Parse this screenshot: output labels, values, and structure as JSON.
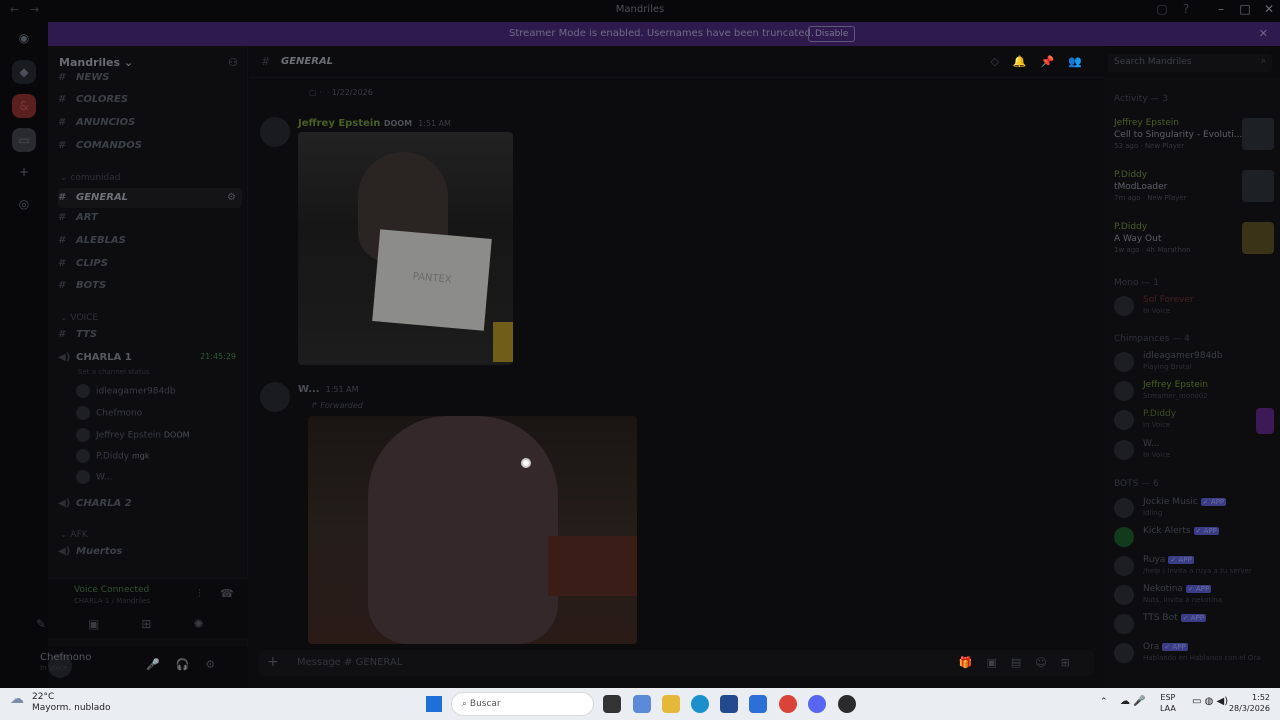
{
  "window": {
    "title": "Mandriles"
  },
  "banner": {
    "message": "Streamer Mode is enabled. Usernames have been truncated.",
    "disable_label": "Disable"
  },
  "server": {
    "name": "Mandriles"
  },
  "channels": [
    {
      "label": "NEWS",
      "active": false
    },
    {
      "label": "COLORES",
      "active": false
    },
    {
      "label": "ANUNCIOS",
      "active": false
    },
    {
      "label": "COMANDOS",
      "active": false
    },
    {
      "label": "GENERAL",
      "active": true
    },
    {
      "label": "ART",
      "active": false
    },
    {
      "label": "ALEBLAS",
      "active": false
    },
    {
      "label": "CLIPS",
      "active": false
    },
    {
      "label": "BOTS",
      "active": false
    },
    {
      "label": "TTS",
      "active": false
    }
  ],
  "categories": {
    "comunidad": "comunidad",
    "voice": "VOICE",
    "afk": "AFK"
  },
  "voice_channel": {
    "name": "CHARLA 1",
    "timer": "21:45:29",
    "status": "Set a channel status",
    "members": [
      {
        "name": "idleagamer984db",
        "tag": ""
      },
      {
        "name": "Chefmono",
        "tag": ""
      },
      {
        "name": "Jeffrey Epstein",
        "tag": "DOOM"
      },
      {
        "name": "P.Diddy",
        "tag": "mgk"
      },
      {
        "name": "W...",
        "tag": ""
      }
    ]
  },
  "other_voice": [
    "CHARLA 2",
    "Muertos"
  ],
  "vc_panel": {
    "title": "Voice Connected",
    "sub": "CHARLA 1 / Mandriles"
  },
  "user": {
    "name": "Chefmono",
    "status": "In Voice"
  },
  "chat": {
    "channel_name": "GENERAL",
    "top_snippet": "1/22/2026",
    "msg1": {
      "author": "Jeffrey Epstein",
      "tag": "DOOM",
      "time": "1:51 AM"
    },
    "msg2": {
      "author": "W...",
      "time": "1:51 AM",
      "forwarded": "Forwarded"
    },
    "paper_text": "PANTEX",
    "composer_placeholder": "Message # GENERAL"
  },
  "search": {
    "placeholder": "Search Mandriles"
  },
  "activity": {
    "header": "Activity — 3",
    "items": [
      {
        "who": "Jeffrey Epstein",
        "game": "Cell to Singularity - Evoluti...",
        "sub": "53 ago · New Player"
      },
      {
        "who": "P.Diddy",
        "game": "tModLoader",
        "sub": "7m ago · New Player"
      },
      {
        "who": "P.Diddy",
        "game": "A Way Out",
        "sub": "1w ago · 4h Marathon"
      }
    ]
  },
  "member_groups": [
    {
      "header": "Mono — 1",
      "members": [
        {
          "name": "Sol Forever",
          "status": "In Voice",
          "app": false
        }
      ]
    },
    {
      "header": "Chimpances — 4",
      "members": [
        {
          "name": "idleagamer984db",
          "status": "Playing Brutal",
          "app": false
        },
        {
          "name": "Jeffrey Epstein",
          "status": "Streamer_mono02",
          "app": false
        },
        {
          "name": "P.Diddy",
          "status": "In Voice",
          "app": false
        },
        {
          "name": "W...",
          "status": "In Voice",
          "app": false
        }
      ]
    },
    {
      "header": "BOTS — 6",
      "members": [
        {
          "name": "Jockie Music",
          "status": "Idling",
          "app": true
        },
        {
          "name": "Kick Alerts",
          "status": "",
          "app": true
        },
        {
          "name": "Ruya",
          "status": "/help | Invita a ruya a tu server",
          "app": true
        },
        {
          "name": "Nekotina",
          "status": "Nuts, invita a nekotina",
          "app": true
        },
        {
          "name": "TTS Bot",
          "status": "",
          "app": true
        },
        {
          "name": "Ora",
          "status": "Hablando en Hablanos con el Ora",
          "app": true
        }
      ]
    }
  ],
  "taskbar": {
    "weather_temp": "22°C",
    "weather_desc": "Mayorm. nublado",
    "search_label": "Buscar",
    "lang1": "ESP",
    "lang2": "LAA",
    "time": "1:52",
    "date": "28/3/2026"
  }
}
